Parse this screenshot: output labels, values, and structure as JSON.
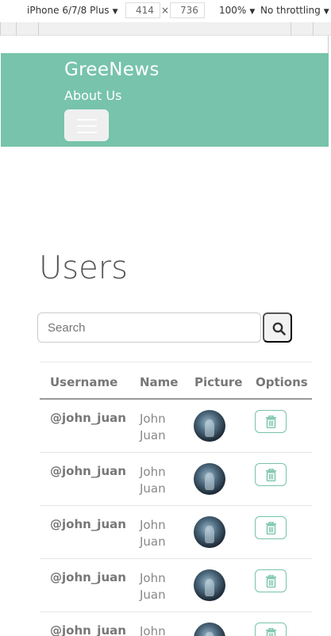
{
  "devtools": {
    "device": "iPhone 6/7/8 Plus",
    "width": "414",
    "height": "736",
    "zoom": "100%",
    "throttling": "No throttling"
  },
  "navbar": {
    "brand": "GreeNews",
    "about": "About Us"
  },
  "page": {
    "title": "Users"
  },
  "search": {
    "placeholder": "Search"
  },
  "table": {
    "headers": [
      "Username",
      "Name",
      "Picture",
      "Options"
    ],
    "rows": [
      {
        "username": "@john_juan",
        "name": "John Juan"
      },
      {
        "username": "@john_juan",
        "name": "John Juan"
      },
      {
        "username": "@john_juan",
        "name": "John Juan"
      },
      {
        "username": "@john_juan",
        "name": "John Juan"
      },
      {
        "username": "@john_juan",
        "name": "John Juan"
      }
    ]
  },
  "colors": {
    "navbar": "#77c3ab",
    "accent": "#77c3ab"
  },
  "icons": [
    "hamburger-icon",
    "search-icon",
    "trash-icon"
  ]
}
